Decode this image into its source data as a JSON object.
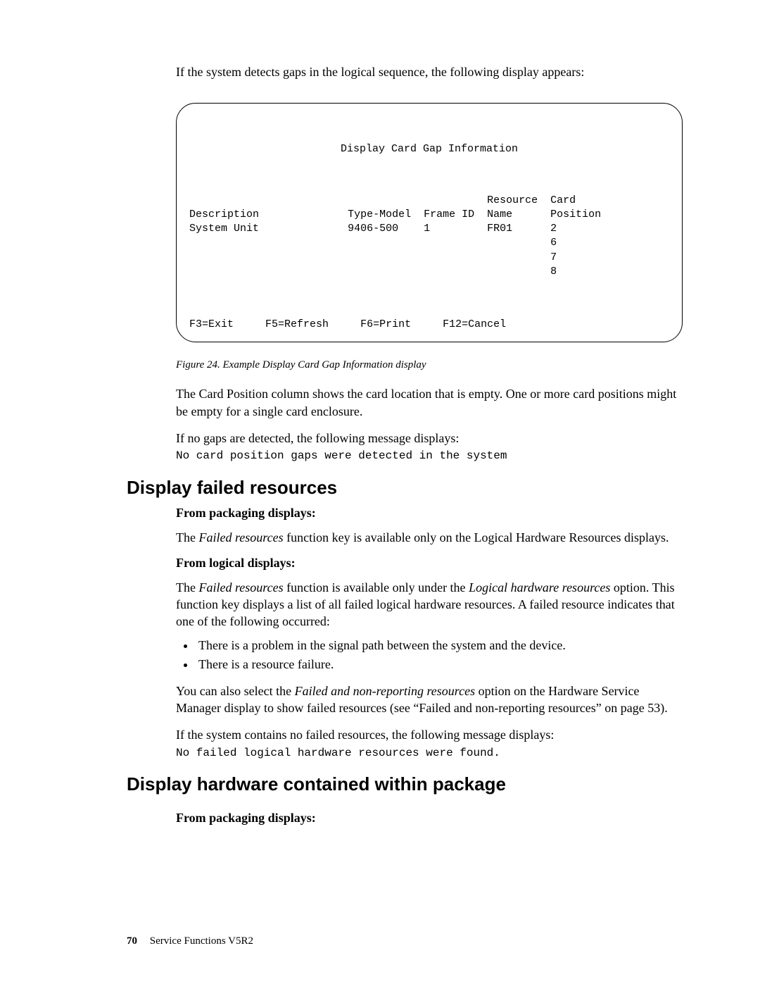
{
  "intro": "If the system detects gaps in the logical sequence, the following display appears:",
  "panel": {
    "title": "Display Card Gap Information",
    "headers": {
      "c1": "Description",
      "c2": "Type-Model",
      "c3": "Frame ID",
      "c4a": "Resource",
      "c4b": "Name",
      "c5a": "Card",
      "c5b": "Position"
    },
    "row": {
      "description": "System Unit",
      "type_model": "9406-500",
      "frame_id": "1",
      "resource_name": "FR01",
      "card_positions": [
        "2",
        "6",
        "7",
        "8"
      ]
    },
    "fkeys": {
      "f3": "F3=Exit",
      "f5": "F5=Refresh",
      "f6": "F6=Print",
      "f12": "F12=Cancel"
    }
  },
  "figure_caption": "Figure 24. Example Display Card Gap Information display",
  "para2": "The Card Position column shows the card location that is empty. One or more card positions might be empty for a single card enclosure.",
  "para3": "If no gaps are detected, the following message displays:",
  "code1": "No card position gaps were detected in the system",
  "h2a": "Display failed resources",
  "h4a": "From packaging displays:",
  "para4_pre": "The ",
  "para4_em": "Failed resources",
  "para4_post": " function key is available only on the Logical Hardware Resources displays.",
  "h4b": "From logical displays:",
  "para5_pre": "The ",
  "para5_em1": "Failed resources",
  "para5_mid": " function is available only under the ",
  "para5_em2": "Logical hardware resources",
  "para5_post": " option. This function key displays a list of all failed logical hardware resources. A failed resource indicates that one of the following occurred:",
  "bullets": [
    "There is a problem in the signal path between the system and the device.",
    "There is a resource failure."
  ],
  "para6_pre": "You can also select the ",
  "para6_em": "Failed and non-reporting resources",
  "para6_post": " option on the Hardware Service Manager display to show failed resources (see “Failed and non-reporting resources” on page 53).",
  "para7": "If the system contains no failed resources, the following message displays:",
  "code2": "No failed logical hardware resources were found.",
  "h2b": "Display hardware contained within package",
  "h4c": "From packaging displays:",
  "footer": {
    "page": "70",
    "title": "Service Functions V5R2"
  }
}
